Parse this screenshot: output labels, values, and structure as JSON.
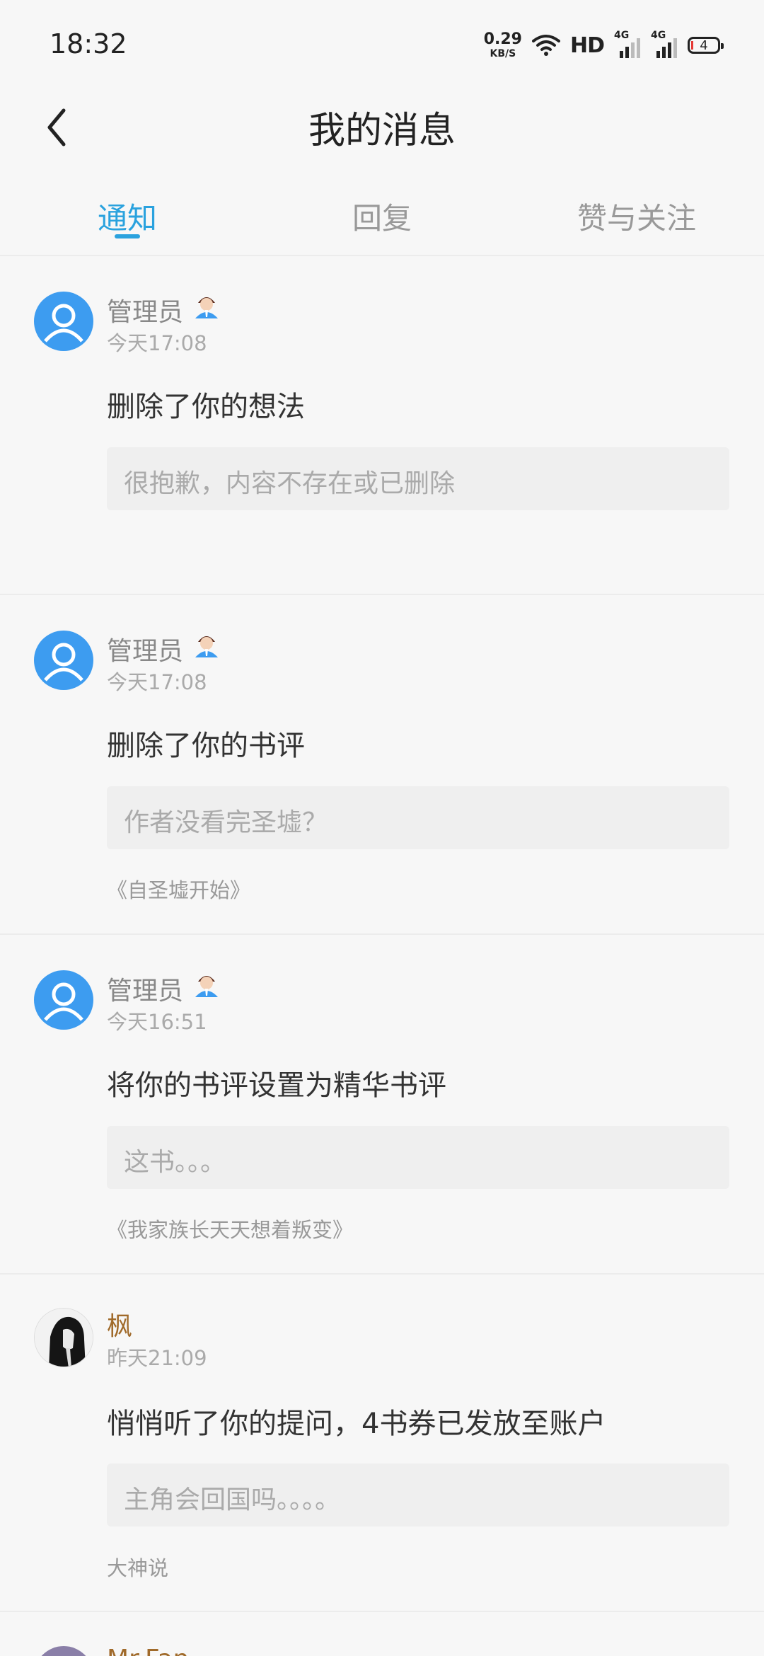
{
  "status": {
    "time": "18:32",
    "speed_value": "0.29",
    "speed_unit": "KB/S",
    "hd": "HD",
    "network1": "4G",
    "network2": "4G",
    "battery": "4",
    "icons": [
      "wifi-icon",
      "signal-icon",
      "battery-icon"
    ]
  },
  "header": {
    "title": "我的消息",
    "back_icon": "chevron-left-icon"
  },
  "tabs": [
    {
      "label": "通知",
      "active": true
    },
    {
      "label": "回复",
      "active": false
    },
    {
      "label": "赞与关注",
      "active": false
    }
  ],
  "colors": {
    "accent": "#2aa2de",
    "avatar_blue": "#3d9cf0",
    "brown_name": "#a06a2a"
  },
  "messages": [
    {
      "user": "管理员",
      "admin": true,
      "time": "今天17:08",
      "text": "删除了你的想法",
      "quote": "很抱歉，内容不存在或已删除",
      "book": ""
    },
    {
      "user": "管理员",
      "admin": true,
      "time": "今天17:08",
      "text": "删除了你的书评",
      "quote": "作者没看完圣墟？",
      "book": "《自圣墟开始》"
    },
    {
      "user": "管理员",
      "admin": true,
      "time": "今天16:51",
      "text": "将你的书评设置为精华书评",
      "quote": "这书。。。",
      "book": "《我家族长天天想着叛变》"
    },
    {
      "user": "枫",
      "admin": false,
      "time": "昨天21:09",
      "text": "悄悄听了你的提问，4书券已发放至账户",
      "quote": "主角会回国吗。。。。",
      "book": "大神说"
    }
  ],
  "partial_next": {
    "user": "Mr.Fan"
  }
}
